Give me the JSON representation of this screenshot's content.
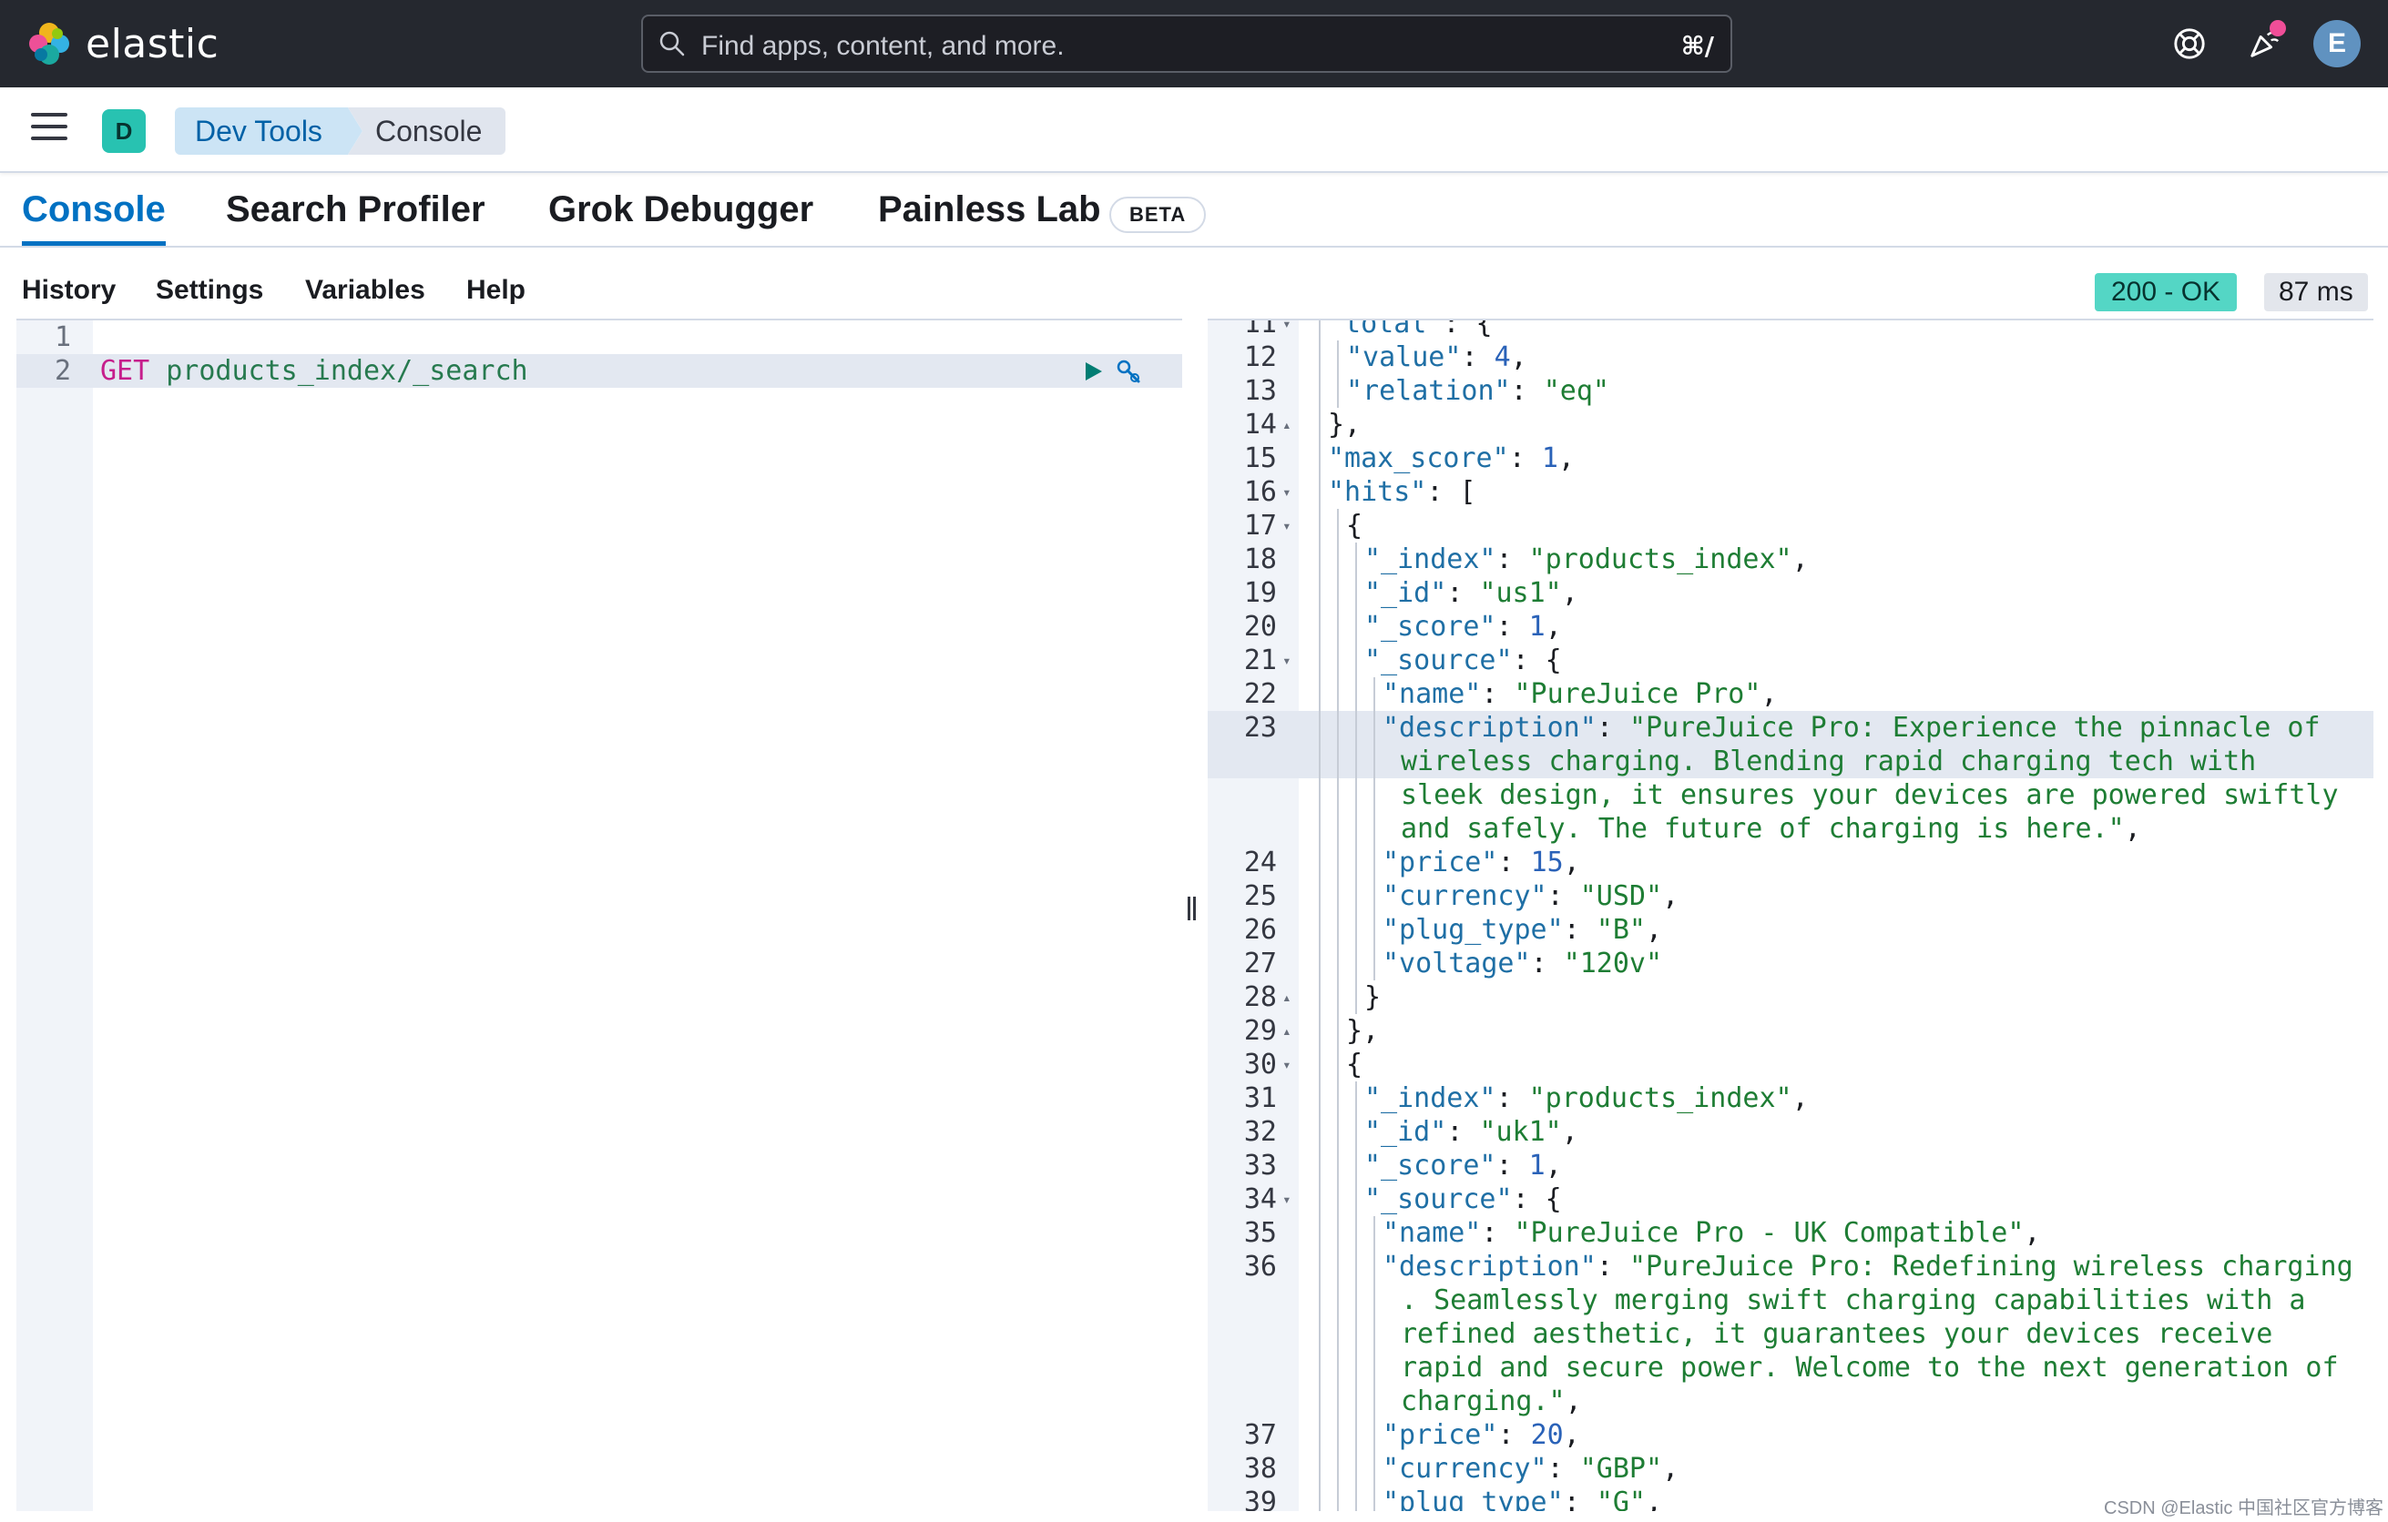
{
  "header": {
    "brand": "elastic",
    "search_placeholder": "Find apps, content, and more.",
    "search_shortcut": "⌘/",
    "user_initial": "E"
  },
  "breadcrumbs": {
    "space_initial": "D",
    "items": [
      "Dev Tools",
      "Console"
    ]
  },
  "tabs": [
    {
      "label": "Console",
      "active": true
    },
    {
      "label": "Search Profiler",
      "active": false
    },
    {
      "label": "Grok Debugger",
      "active": false
    },
    {
      "label": "Painless Lab",
      "active": false
    }
  ],
  "beta_badge": "BETA",
  "toolbar": {
    "items": [
      "History",
      "Settings",
      "Variables",
      "Help"
    ],
    "status": "200 - OK",
    "time": "87 ms"
  },
  "request_editor": {
    "lines": [
      {
        "num": "1",
        "method": "",
        "path": ""
      },
      {
        "num": "2",
        "method": "GET",
        "path": "products_index/_search"
      }
    ]
  },
  "response_editor": {
    "lines": [
      {
        "num": "11",
        "fold": "▾",
        "indent": 1,
        "parts": [
          [
            "key",
            "\"total\""
          ],
          [
            "punc",
            ": {"
          ]
        ]
      },
      {
        "num": "12",
        "fold": "",
        "indent": 2,
        "parts": [
          [
            "key",
            "\"value\""
          ],
          [
            "punc",
            ": "
          ],
          [
            "num",
            "4"
          ],
          [
            "punc",
            ","
          ]
        ]
      },
      {
        "num": "13",
        "fold": "",
        "indent": 2,
        "parts": [
          [
            "key",
            "\"relation\""
          ],
          [
            "punc",
            ": "
          ],
          [
            "str",
            "\"eq\""
          ]
        ]
      },
      {
        "num": "14",
        "fold": "▴",
        "indent": 1,
        "parts": [
          [
            "punc",
            "},"
          ]
        ]
      },
      {
        "num": "15",
        "fold": "",
        "indent": 1,
        "parts": [
          [
            "key",
            "\"max_score\""
          ],
          [
            "punc",
            ": "
          ],
          [
            "num",
            "1"
          ],
          [
            "punc",
            ","
          ]
        ]
      },
      {
        "num": "16",
        "fold": "▾",
        "indent": 1,
        "parts": [
          [
            "key",
            "\"hits\""
          ],
          [
            "punc",
            ": ["
          ]
        ]
      },
      {
        "num": "17",
        "fold": "▾",
        "indent": 2,
        "parts": [
          [
            "punc",
            "{"
          ]
        ]
      },
      {
        "num": "18",
        "fold": "",
        "indent": 3,
        "parts": [
          [
            "key",
            "\"_index\""
          ],
          [
            "punc",
            ": "
          ],
          [
            "str",
            "\"products_index\""
          ],
          [
            "punc",
            ","
          ]
        ]
      },
      {
        "num": "19",
        "fold": "",
        "indent": 3,
        "parts": [
          [
            "key",
            "\"_id\""
          ],
          [
            "punc",
            ": "
          ],
          [
            "str",
            "\"us1\""
          ],
          [
            "punc",
            ","
          ]
        ]
      },
      {
        "num": "20",
        "fold": "",
        "indent": 3,
        "parts": [
          [
            "key",
            "\"_score\""
          ],
          [
            "punc",
            ": "
          ],
          [
            "num",
            "1"
          ],
          [
            "punc",
            ","
          ]
        ]
      },
      {
        "num": "21",
        "fold": "▾",
        "indent": 3,
        "parts": [
          [
            "key",
            "\"_source\""
          ],
          [
            "punc",
            ": {"
          ]
        ]
      },
      {
        "num": "22",
        "fold": "",
        "indent": 4,
        "parts": [
          [
            "key",
            "\"name\""
          ],
          [
            "punc",
            ": "
          ],
          [
            "str",
            "\"PureJuice Pro\""
          ],
          [
            "punc",
            ","
          ]
        ]
      },
      {
        "num": "23",
        "fold": "",
        "indent": 4,
        "active": true,
        "parts": [
          [
            "key",
            "\"description\""
          ],
          [
            "punc",
            ": "
          ],
          [
            "str",
            "\"PureJuice Pro: Experience the pinnacle of"
          ]
        ]
      },
      {
        "num": "",
        "fold": "",
        "indent": 5,
        "active": true,
        "parts": [
          [
            "str",
            "wireless charging. Blending rapid charging tech with"
          ]
        ]
      },
      {
        "num": "",
        "fold": "",
        "indent": 5,
        "parts": [
          [
            "str",
            "sleek design, it ensures your devices are powered swiftly"
          ]
        ]
      },
      {
        "num": "",
        "fold": "",
        "indent": 5,
        "parts": [
          [
            "str",
            "and safely. The future of charging is here.\""
          ],
          [
            "punc",
            ","
          ]
        ]
      },
      {
        "num": "24",
        "fold": "",
        "indent": 4,
        "parts": [
          [
            "key",
            "\"price\""
          ],
          [
            "punc",
            ": "
          ],
          [
            "num",
            "15"
          ],
          [
            "punc",
            ","
          ]
        ]
      },
      {
        "num": "25",
        "fold": "",
        "indent": 4,
        "parts": [
          [
            "key",
            "\"currency\""
          ],
          [
            "punc",
            ": "
          ],
          [
            "str",
            "\"USD\""
          ],
          [
            "punc",
            ","
          ]
        ]
      },
      {
        "num": "26",
        "fold": "",
        "indent": 4,
        "parts": [
          [
            "key",
            "\"plug_type\""
          ],
          [
            "punc",
            ": "
          ],
          [
            "str",
            "\"B\""
          ],
          [
            "punc",
            ","
          ]
        ]
      },
      {
        "num": "27",
        "fold": "",
        "indent": 4,
        "parts": [
          [
            "key",
            "\"voltage\""
          ],
          [
            "punc",
            ": "
          ],
          [
            "str",
            "\"120v\""
          ]
        ]
      },
      {
        "num": "28",
        "fold": "▴",
        "indent": 3,
        "parts": [
          [
            "punc",
            "}"
          ]
        ]
      },
      {
        "num": "29",
        "fold": "▴",
        "indent": 2,
        "parts": [
          [
            "punc",
            "},"
          ]
        ]
      },
      {
        "num": "30",
        "fold": "▾",
        "indent": 2,
        "parts": [
          [
            "punc",
            "{"
          ]
        ]
      },
      {
        "num": "31",
        "fold": "",
        "indent": 3,
        "parts": [
          [
            "key",
            "\"_index\""
          ],
          [
            "punc",
            ": "
          ],
          [
            "str",
            "\"products_index\""
          ],
          [
            "punc",
            ","
          ]
        ]
      },
      {
        "num": "32",
        "fold": "",
        "indent": 3,
        "parts": [
          [
            "key",
            "\"_id\""
          ],
          [
            "punc",
            ": "
          ],
          [
            "str",
            "\"uk1\""
          ],
          [
            "punc",
            ","
          ]
        ]
      },
      {
        "num": "33",
        "fold": "",
        "indent": 3,
        "parts": [
          [
            "key",
            "\"_score\""
          ],
          [
            "punc",
            ": "
          ],
          [
            "num",
            "1"
          ],
          [
            "punc",
            ","
          ]
        ]
      },
      {
        "num": "34",
        "fold": "▾",
        "indent": 3,
        "parts": [
          [
            "key",
            "\"_source\""
          ],
          [
            "punc",
            ": {"
          ]
        ]
      },
      {
        "num": "35",
        "fold": "",
        "indent": 4,
        "parts": [
          [
            "key",
            "\"name\""
          ],
          [
            "punc",
            ": "
          ],
          [
            "str",
            "\"PureJuice Pro - UK Compatible\""
          ],
          [
            "punc",
            ","
          ]
        ]
      },
      {
        "num": "36",
        "fold": "",
        "indent": 4,
        "parts": [
          [
            "key",
            "\"description\""
          ],
          [
            "punc",
            ": "
          ],
          [
            "str",
            "\"PureJuice Pro: Redefining wireless charging"
          ]
        ]
      },
      {
        "num": "",
        "fold": "",
        "indent": 5,
        "parts": [
          [
            "str",
            ". Seamlessly merging swift charging capabilities with a"
          ]
        ]
      },
      {
        "num": "",
        "fold": "",
        "indent": 5,
        "parts": [
          [
            "str",
            "refined aesthetic, it guarantees your devices receive"
          ]
        ]
      },
      {
        "num": "",
        "fold": "",
        "indent": 5,
        "parts": [
          [
            "str",
            "rapid and secure power. Welcome to the next generation of"
          ]
        ]
      },
      {
        "num": "",
        "fold": "",
        "indent": 5,
        "parts": [
          [
            "str",
            "charging.\""
          ],
          [
            "punc",
            ","
          ]
        ]
      },
      {
        "num": "37",
        "fold": "",
        "indent": 4,
        "parts": [
          [
            "key",
            "\"price\""
          ],
          [
            "punc",
            ": "
          ],
          [
            "num",
            "20"
          ],
          [
            "punc",
            ","
          ]
        ]
      },
      {
        "num": "38",
        "fold": "",
        "indent": 4,
        "parts": [
          [
            "key",
            "\"currency\""
          ],
          [
            "punc",
            ": "
          ],
          [
            "str",
            "\"GBP\""
          ],
          [
            "punc",
            ","
          ]
        ]
      },
      {
        "num": "39",
        "fold": "",
        "indent": 4,
        "parts": [
          [
            "key",
            "\"plug_type\""
          ],
          [
            "punc",
            ": "
          ],
          [
            "str",
            "\"G\""
          ],
          [
            "punc",
            ","
          ]
        ]
      }
    ]
  },
  "watermark": "CSDN @Elastic 中国社区官方博客"
}
